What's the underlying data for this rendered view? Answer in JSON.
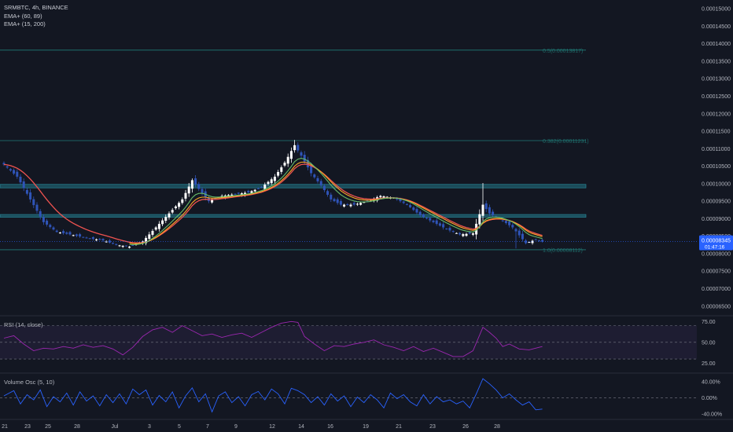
{
  "legend": {
    "symbol": "SRMBTC, 4h, BINANCE",
    "ema1": "EMA+ (60, 89)",
    "ema2": "EMA+ (15, 200)"
  },
  "rsi": {
    "label": "RSI (14, close)"
  },
  "vosc": {
    "label": "Volume Osc (5, 10)"
  },
  "price_badge": {
    "price": "0.00008345",
    "timer": "01:47:16"
  },
  "fib_labels": [
    "0.5(0.00013817)",
    "0.382(0.00011231)",
    "1.0(0.00008112)"
  ],
  "colors": {
    "background": "#131722",
    "candle_up": "#ffffff",
    "candle_down": "#2f54b8",
    "ema_fast": "#66bb6a",
    "ema_slow": "#ffa726",
    "ema_red": "#ef5350",
    "zone": "#1f5f6e",
    "rsi_line": "#9c27b0",
    "vosc_line": "#2962ff",
    "badge": "#2962ff"
  },
  "chart_data": [
    {
      "type": "candlestick",
      "title": "SRMBTC, 4h, BINANCE",
      "y_ticks": [
        "0.00015000",
        "0.00014500",
        "0.00014000",
        "0.00013500",
        "0.00013000",
        "0.00012500",
        "0.00012000",
        "0.00011500",
        "0.00011000",
        "0.00010500",
        "0.00010000",
        "0.00009500",
        "0.00009000",
        "0.00008500",
        "0.00008000",
        "0.00007500",
        "0.00007000",
        "0.00006500"
      ],
      "ylim": [
        6.27e-05,
        0.0001525
      ],
      "x_ticks": [
        "21",
        "23",
        "25",
        "28",
        "Jul",
        "3",
        "5",
        "7",
        "9",
        "12",
        "14",
        "16",
        "19",
        "21",
        "23",
        "26",
        "28"
      ],
      "current_price": 8.345e-05,
      "fib_levels": [
        {
          "label": "0.5(0.00013817)",
          "value": 0.00013817
        },
        {
          "label": "0.382(0.00011231)",
          "value": 0.00011231
        },
        {
          "label": "1.0(0.00008112)",
          "value": 8.112e-05
        }
      ],
      "zones": [
        {
          "low": 9.88e-05,
          "high": 9.98e-05
        },
        {
          "low": 9.04e-05,
          "high": 9.12e-05
        }
      ],
      "close_path": [
        [
          0,
          0.0001055
        ],
        [
          4,
          0.000102
        ],
        [
          8,
          9.55e-05
        ],
        [
          12,
          8.9e-05
        ],
        [
          16,
          8.62e-05
        ],
        [
          20,
          8.55e-05
        ],
        [
          25,
          8.45e-05
        ],
        [
          30,
          8.38e-05
        ],
        [
          34,
          8.25e-05
        ],
        [
          38,
          8.2e-05
        ],
        [
          42,
          8.35e-05
        ],
        [
          46,
          8.75e-05
        ],
        [
          50,
          9.15e-05
        ],
        [
          54,
          9.55e-05
        ],
        [
          57,
          0.000101
        ],
        [
          59,
          9.85e-05
        ],
        [
          62,
          9.5e-05
        ],
        [
          66,
          9.65e-05
        ],
        [
          70,
          9.7e-05
        ],
        [
          74,
          9.75e-05
        ],
        [
          78,
          9.9e-05
        ],
        [
          82,
          0.000102
        ],
        [
          85,
          0.000106
        ],
        [
          88,
          0.000111
        ],
        [
          90,
          0.000108
        ],
        [
          93,
          0.000103
        ],
        [
          96,
          9.95e-05
        ],
        [
          99,
          9.55e-05
        ],
        [
          102,
          9.4e-05
        ],
        [
          106,
          9.4e-05
        ],
        [
          110,
          9.5e-05
        ],
        [
          114,
          9.65e-05
        ],
        [
          118,
          9.6e-05
        ],
        [
          122,
          9.4e-05
        ],
        [
          126,
          9.1e-05
        ],
        [
          130,
          8.9e-05
        ],
        [
          134,
          8.7e-05
        ],
        [
          138,
          8.55e-05
        ],
        [
          142,
          8.58e-05
        ],
        [
          145,
          9.4e-05
        ],
        [
          147,
          9.15e-05
        ],
        [
          150,
          9e-05
        ],
        [
          154,
          8.75e-05
        ],
        [
          158,
          8.3e-05
        ],
        [
          161,
          8.4e-05
        ],
        [
          163,
          8.345e-05
        ]
      ],
      "spikes": [
        {
          "at": 57,
          "high": 0.0001015
        },
        {
          "at": 88,
          "high": 0.0001125
        },
        {
          "at": 145,
          "high": 0.0001002
        },
        {
          "at": 155,
          "low": 8.15e-05
        }
      ],
      "candle_count": 164
    },
    {
      "type": "line",
      "title": "RSI (14, close)",
      "y_ticks": [
        "75.00",
        "50.00",
        "25.00"
      ],
      "ylim": [
        15,
        80
      ],
      "band": [
        30,
        70
      ],
      "midline": 50,
      "values": [
        [
          0,
          55
        ],
        [
          3,
          58
        ],
        [
          6,
          48
        ],
        [
          9,
          40
        ],
        [
          12,
          43
        ],
        [
          15,
          42
        ],
        [
          18,
          45
        ],
        [
          21,
          43
        ],
        [
          24,
          47
        ],
        [
          27,
          44
        ],
        [
          30,
          46
        ],
        [
          33,
          42
        ],
        [
          36,
          35
        ],
        [
          39,
          44
        ],
        [
          42,
          57
        ],
        [
          45,
          65
        ],
        [
          48,
          68
        ],
        [
          51,
          62
        ],
        [
          54,
          70
        ],
        [
          57,
          64
        ],
        [
          60,
          58
        ],
        [
          63,
          60
        ],
        [
          66,
          56
        ],
        [
          69,
          59
        ],
        [
          72,
          61
        ],
        [
          75,
          56
        ],
        [
          78,
          62
        ],
        [
          81,
          68
        ],
        [
          84,
          73
        ],
        [
          87,
          75
        ],
        [
          89,
          74
        ],
        [
          91,
          57
        ],
        [
          94,
          48
        ],
        [
          97,
          40
        ],
        [
          100,
          46
        ],
        [
          103,
          45
        ],
        [
          106,
          48
        ],
        [
          109,
          50
        ],
        [
          112,
          53
        ],
        [
          115,
          47
        ],
        [
          118,
          44
        ],
        [
          121,
          40
        ],
        [
          124,
          45
        ],
        [
          127,
          39
        ],
        [
          130,
          43
        ],
        [
          133,
          38
        ],
        [
          136,
          33
        ],
        [
          139,
          33
        ],
        [
          142,
          40
        ],
        [
          145,
          68
        ],
        [
          147,
          62
        ],
        [
          149,
          55
        ],
        [
          151,
          45
        ],
        [
          153,
          48
        ],
        [
          156,
          42
        ],
        [
          159,
          41
        ],
        [
          162,
          44
        ],
        [
          163,
          45
        ]
      ]
    },
    {
      "type": "line",
      "title": "Volume Osc (5, 10)",
      "y_ticks": [
        "40.00%",
        "0.00%",
        "-40.00%"
      ],
      "ylim": [
        -50,
        58
      ],
      "zero_line": 0,
      "values": [
        [
          0,
          5
        ],
        [
          3,
          18
        ],
        [
          5,
          -15
        ],
        [
          7,
          8
        ],
        [
          9,
          -5
        ],
        [
          11,
          20
        ],
        [
          13,
          -22
        ],
        [
          15,
          3
        ],
        [
          17,
          -10
        ],
        [
          19,
          12
        ],
        [
          21,
          -18
        ],
        [
          23,
          15
        ],
        [
          25,
          -8
        ],
        [
          27,
          5
        ],
        [
          29,
          -20
        ],
        [
          31,
          8
        ],
        [
          33,
          -12
        ],
        [
          35,
          10
        ],
        [
          37,
          -15
        ],
        [
          39,
          22
        ],
        [
          41,
          8
        ],
        [
          43,
          20
        ],
        [
          45,
          -18
        ],
        [
          47,
          6
        ],
        [
          49,
          -10
        ],
        [
          51,
          15
        ],
        [
          53,
          -25
        ],
        [
          55,
          5
        ],
        [
          57,
          25
        ],
        [
          59,
          -10
        ],
        [
          61,
          10
        ],
        [
          63,
          -35
        ],
        [
          65,
          5
        ],
        [
          67,
          15
        ],
        [
          69,
          -12
        ],
        [
          71,
          3
        ],
        [
          73,
          -20
        ],
        [
          75,
          8
        ],
        [
          77,
          16
        ],
        [
          79,
          -5
        ],
        [
          81,
          22
        ],
        [
          83,
          10
        ],
        [
          85,
          -15
        ],
        [
          87,
          24
        ],
        [
          89,
          18
        ],
        [
          91,
          8
        ],
        [
          93,
          -12
        ],
        [
          95,
          3
        ],
        [
          97,
          -18
        ],
        [
          99,
          10
        ],
        [
          101,
          -8
        ],
        [
          103,
          5
        ],
        [
          105,
          -22
        ],
        [
          107,
          2
        ],
        [
          109,
          -12
        ],
        [
          111,
          8
        ],
        [
          113,
          -5
        ],
        [
          115,
          -25
        ],
        [
          117,
          12
        ],
        [
          119,
          -2
        ],
        [
          121,
          8
        ],
        [
          123,
          -10
        ],
        [
          125,
          -20
        ],
        [
          127,
          8
        ],
        [
          129,
          -15
        ],
        [
          131,
          3
        ],
        [
          133,
          -10
        ],
        [
          135,
          -5
        ],
        [
          137,
          -15
        ],
        [
          139,
          -8
        ],
        [
          141,
          -25
        ],
        [
          143,
          10
        ],
        [
          145,
          48
        ],
        [
          147,
          35
        ],
        [
          149,
          20
        ],
        [
          151,
          0
        ],
        [
          153,
          10
        ],
        [
          155,
          -5
        ],
        [
          157,
          -18
        ],
        [
          159,
          -10
        ],
        [
          161,
          -30
        ],
        [
          163,
          -28
        ]
      ]
    }
  ]
}
